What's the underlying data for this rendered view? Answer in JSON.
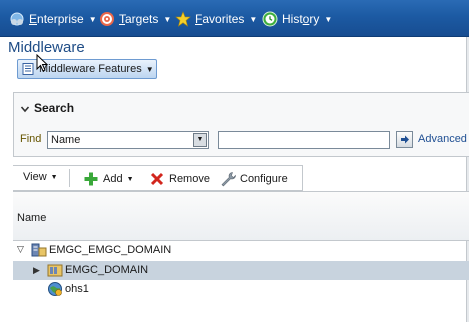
{
  "topnav": {
    "items": [
      {
        "label_pre": "",
        "label_u": "E",
        "label_post": "nterprise",
        "icon": "enterprise-icon"
      },
      {
        "label_pre": "",
        "label_u": "T",
        "label_post": "argets",
        "icon": "targets-icon"
      },
      {
        "label_pre": "",
        "label_u": "F",
        "label_post": "avorites",
        "icon": "favorites-star-icon"
      },
      {
        "label_pre": "Hist",
        "label_u": "o",
        "label_post": "ry",
        "icon": "history-icon"
      }
    ]
  },
  "page": {
    "title": "Middleware"
  },
  "features_button": {
    "label": "Middleware Features"
  },
  "search": {
    "header": "Search",
    "find_label": "Find",
    "field_selected": "Name",
    "text_value": "",
    "advanced_label": "Advanced"
  },
  "toolbar": {
    "view_label": "View",
    "add_label": "Add",
    "remove_label": "Remove",
    "configure_label": "Configure"
  },
  "table": {
    "column_name": "Name",
    "rows": [
      {
        "label": "EMGC_EMGC_DOMAIN",
        "icon": "weblogic-domain-icon",
        "disclosure": "expanded"
      },
      {
        "label": "EMGC_DOMAIN",
        "icon": "domain-folder-icon",
        "disclosure": "collapsed",
        "selected": true
      },
      {
        "label": "ohs1",
        "icon": "http-server-icon",
        "disclosure": "none"
      }
    ]
  },
  "colors": {
    "topbar": "#1c5aa3",
    "title": "#1e4c86",
    "selected_row": "#c8d3de",
    "link": "#1f4f93"
  }
}
